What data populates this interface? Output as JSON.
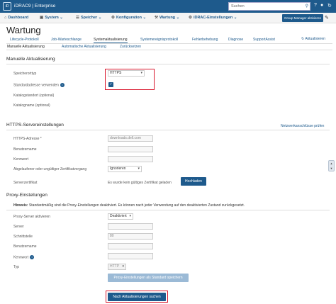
{
  "topbar": {
    "logo": "iD",
    "title": "iDRAC9 | Enterprise",
    "search_placeholder": "Suchen",
    "icons": [
      "search-icon",
      "help-icon",
      "user-icon",
      "refresh-icon"
    ]
  },
  "nav": {
    "items": [
      "Dashboard",
      "System",
      "Speicher",
      "Konfiguration",
      "Wartung",
      "iDRAC-Einstellungen"
    ],
    "group_manager": "Group Manager aktivieren"
  },
  "page": {
    "title": "Wartung"
  },
  "tabs": {
    "items": [
      "Lifecycle-Protokoll",
      "Job-Warteschlange",
      "Systemaktualisierung",
      "Systemereignisprotokoll",
      "Fehlerbehebung",
      "Diagnose",
      "SupportAssist"
    ],
    "active": "Systemaktualisierung",
    "refresh": "Aktualisieren"
  },
  "subtabs": {
    "items": [
      "Manuelle Aktualisierung",
      "Automatische Aktualisierung",
      "Zurücksetzen"
    ],
    "active": "Manuelle Aktualisierung"
  },
  "manual": {
    "section": "Manuelle Aktualisierung",
    "storage_type_label": "Speicherorttyp",
    "storage_type_value": "HTTPS",
    "default_address_label": "Standardadresse verwenden",
    "default_address_checked": true,
    "catalog_location_label": "Katalogstandort (optional)",
    "catalog_name_label": "Katalogname (optional)"
  },
  "https": {
    "section": "HTTPS-Servereinstellungen",
    "proxy_link": "Netzwerkanschlüsse prüfen",
    "address_label": "HTTPS-Adresse *",
    "address_value": "downloads.dell.com",
    "user_label": "Benutzername",
    "password_label": "Kennwort",
    "cert_label": "Abgelaufener oder ungültiger Zertifikatvorgang",
    "cert_value": "Ignorieren",
    "server_cert_label": "Serverzertifikat",
    "server_cert_status": "Es wurde kein gültiges Zertifikat geladen",
    "upload_button": "Hochladen"
  },
  "proxy": {
    "section": "Proxy-Einstellungen",
    "hint_bold": "Hinweis:",
    "hint_text": "Standardmäßig sind die Proxy-Einstellungen deaktiviert. Es können nach jeder Verwendung auf den deaktivierten Zustand zurückgesetzt.",
    "enable_label": "Proxy-Server aktivieren",
    "enable_value": "Deaktiviert",
    "server_label": "Server",
    "port_label": "Schnittstelle",
    "port_value": "80",
    "user_label": "Benutzername",
    "password_label": "Kennwort",
    "type_label": "Typ",
    "type_value": "HTTP",
    "default_button": "Proxy-Einstellungen als Standard speichern"
  },
  "actions": {
    "check_updates": "Nach Aktualisierungen suchen"
  },
  "colors": {
    "brand": "#1e5a8c",
    "highlight": "#d9182e"
  }
}
